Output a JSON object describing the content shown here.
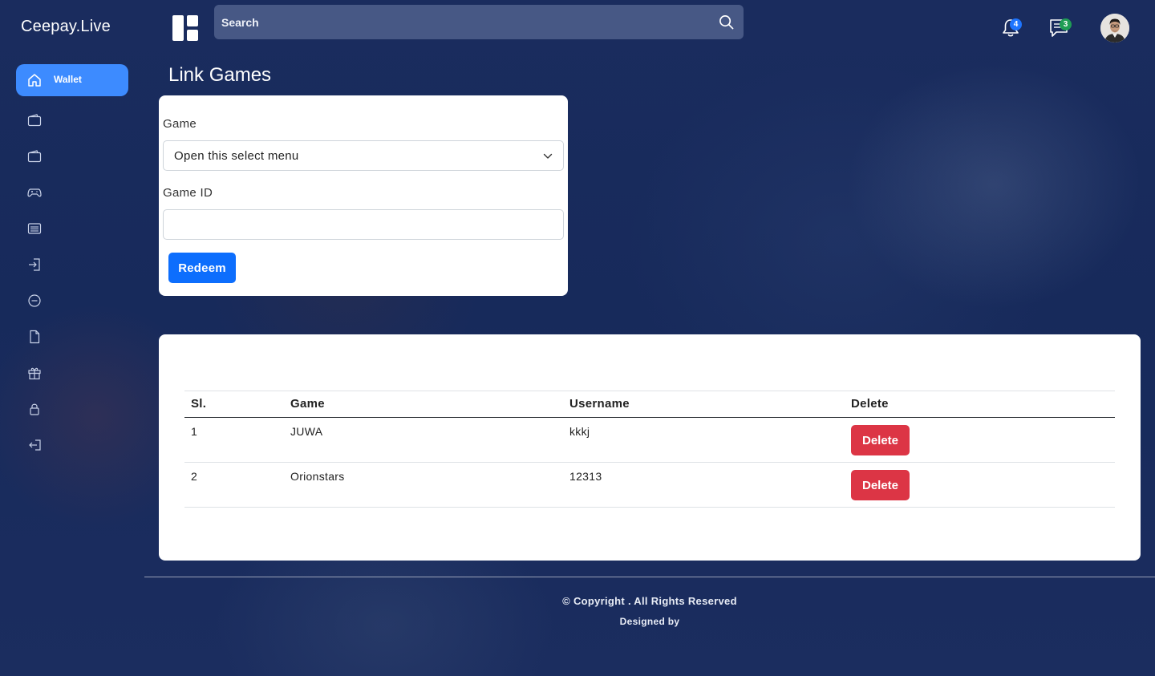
{
  "brand": "Ceepay.Live",
  "search": {
    "placeholder": "Search"
  },
  "notifications": {
    "count": "4"
  },
  "messages": {
    "count": "3"
  },
  "sidebar": {
    "active_label": "Wallet",
    "icons": [
      "wallet-icon",
      "wallet-icon",
      "gamepad-icon",
      "list-icon",
      "login-icon",
      "minus-circle-icon",
      "file-icon",
      "gift-icon",
      "lock-icon",
      "logout-icon"
    ]
  },
  "page": {
    "title": "Link Games"
  },
  "form": {
    "game_label": "Game",
    "game_select_value": "Open this select menu",
    "game_id_label": "Game ID",
    "game_id_value": "",
    "redeem_label": "Redeem"
  },
  "table": {
    "headers": [
      "Sl.",
      "Game",
      "Username",
      "Delete"
    ],
    "rows": [
      {
        "sl": "1",
        "game": "JUWA",
        "username": "kkkj",
        "action": "Delete"
      },
      {
        "sl": "2",
        "game": "Orionstars",
        "username": "12313",
        "action": "Delete"
      }
    ]
  },
  "footer": {
    "copyright": "© Copyright . All Rights Reserved",
    "designed_by": "Designed by"
  },
  "colors": {
    "primary": "#0d6efd",
    "danger": "#dc3545",
    "sidebar_active": "#3d8bff",
    "background": "#16285a"
  }
}
